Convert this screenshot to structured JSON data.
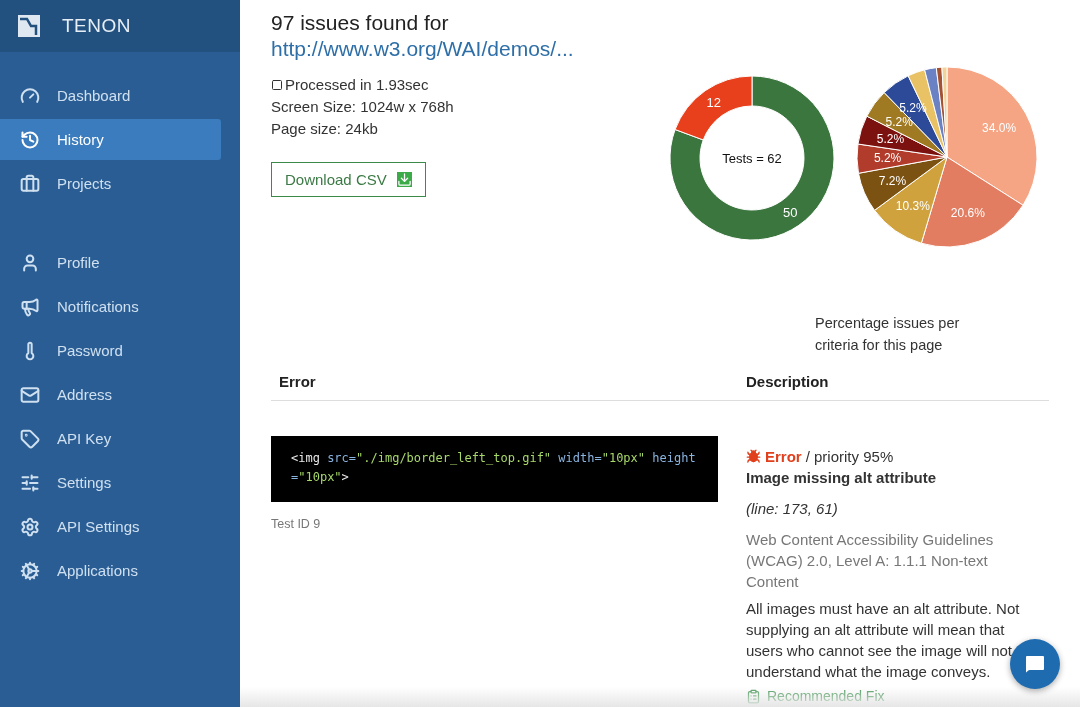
{
  "brand": {
    "name": "TENON"
  },
  "sidebar": {
    "items": [
      {
        "label": "Dashboard",
        "selected": false
      },
      {
        "label": "History",
        "selected": true
      },
      {
        "label": "Projects",
        "selected": false
      },
      {
        "label": "Profile",
        "selected": false
      },
      {
        "label": "Notifications",
        "selected": false
      },
      {
        "label": "Password",
        "selected": false
      },
      {
        "label": "Address",
        "selected": false
      },
      {
        "label": "API Key",
        "selected": false
      },
      {
        "label": "Settings",
        "selected": false
      },
      {
        "label": "API Settings",
        "selected": false
      },
      {
        "label": "Applications",
        "selected": false
      }
    ]
  },
  "summary": {
    "heading": "97 issues found for",
    "url": "http://www.w3.org/WAI/demos/...",
    "processed": "Processed in 1.93sec",
    "screen_size": "Screen Size: 1024w x 768h",
    "page_size": "Page size: 24kb",
    "download_button": "Download CSV"
  },
  "tests_chart": {
    "center_label": "Tests = 62",
    "chart_data": {
      "type": "donut",
      "values": [
        50,
        12
      ],
      "colors": [
        "#3b763f",
        "#e8401c"
      ],
      "data_labels": true
    }
  },
  "criteria_chart": {
    "caption": "Percentage issues per criteria for this page",
    "chart_data": {
      "type": "pie",
      "values": [
        34.0,
        20.6,
        10.3,
        7.2,
        5.2,
        5.2,
        5.2,
        5.2,
        3.1,
        2.1,
        1.0,
        0.9
      ],
      "colors": [
        "#f5a584",
        "#e27d62",
        "#d0a23e",
        "#7c5212",
        "#b23c2c",
        "#7c1210",
        "#a07a22",
        "#2c4a98",
        "#e8c264",
        "#6a82c4",
        "#a45234",
        "#f2d49a"
      ],
      "value_labels": [
        "34.0%",
        "20.6%",
        "10.3%",
        "7.2%",
        "5.2%",
        "5.2%",
        "5.2%",
        "5.2%",
        null,
        null,
        null,
        null
      ]
    }
  },
  "table": {
    "columns": [
      "Error",
      "Description"
    ],
    "rows": [
      {
        "code": [
          {
            "kind": "tag",
            "text": "<img"
          },
          {
            "kind": "attr",
            "text": " src="
          },
          {
            "kind": "value",
            "text": "\"./img/border_left_top.gif\""
          },
          {
            "kind": "attr",
            "text": " width="
          },
          {
            "kind": "value",
            "text": "\"10px\""
          },
          {
            "kind": "attr",
            "text": " height="
          },
          {
            "kind": "value",
            "text": "\"10px\""
          },
          {
            "kind": "tag",
            "text": ">"
          }
        ],
        "test_id": "Test ID 9",
        "severity": "Error",
        "priority": "/  priority 95%",
        "title": "Image missing alt attribute",
        "line": "(line: 173, 61)",
        "guideline": "Web Content Accessibility Guidelines (WCAG) 2.0, Level A: 1.1.1 Non-text Content",
        "description": "All images must have an alt attribute. Not supplying an alt attribute will mean that users who cannot see the image will not understand what the image conveys.",
        "fix_link": "Recommended Fix"
      }
    ]
  }
}
